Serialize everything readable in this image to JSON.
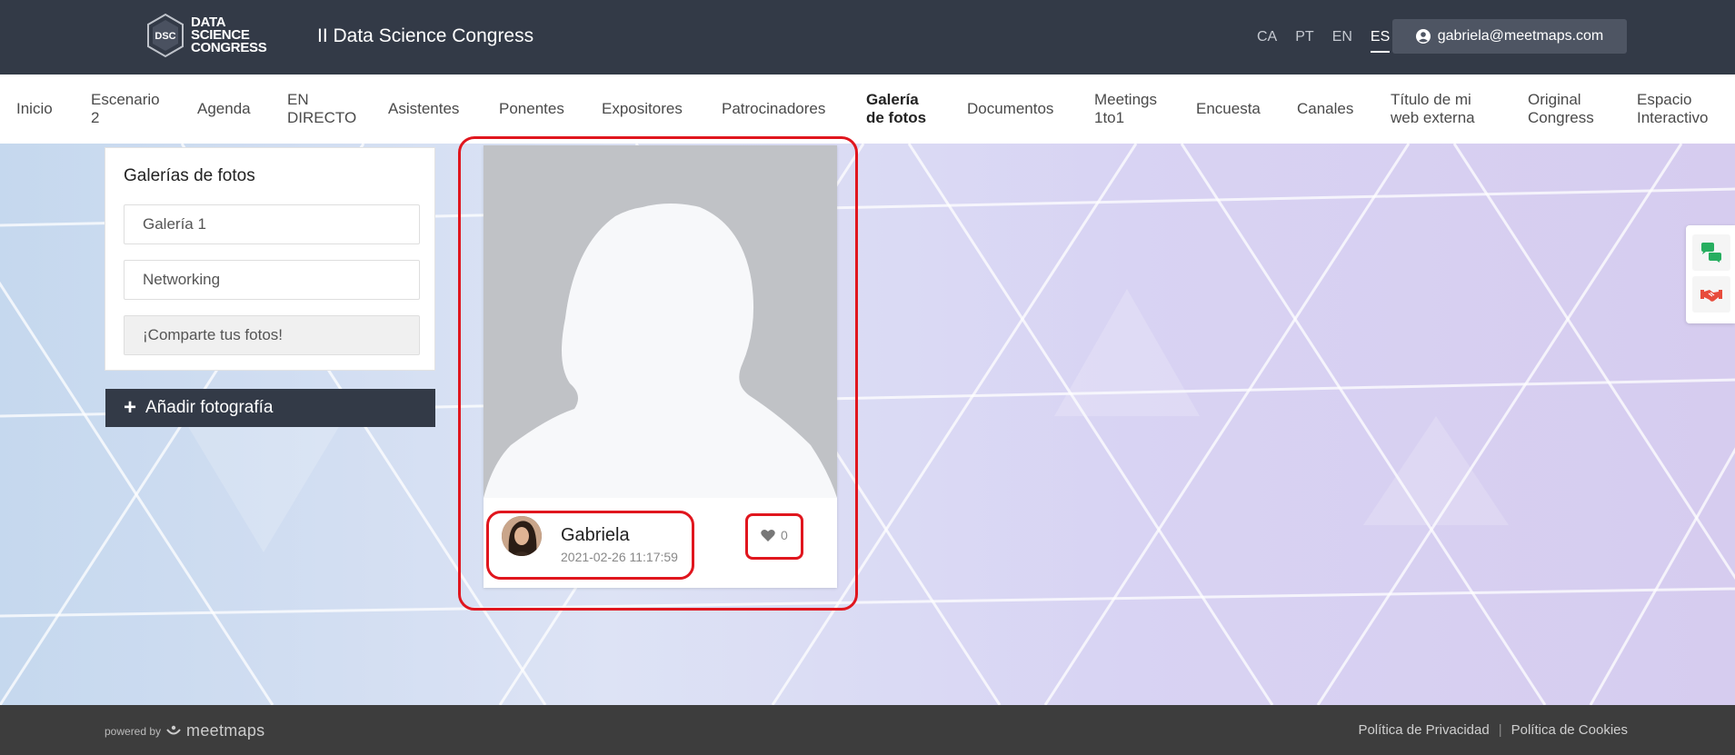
{
  "header": {
    "logo_lines": [
      "DATA",
      "SCIENCE",
      "CONGRESS"
    ],
    "logo_badge": "DSC",
    "title": "II Data Science Congress",
    "languages": [
      "CA",
      "PT",
      "EN",
      "ES"
    ],
    "active_language": "ES",
    "user_email": "gabriela@meetmaps.com"
  },
  "nav": {
    "items": [
      {
        "label": "Inicio"
      },
      {
        "label": "Escenario 2"
      },
      {
        "label": "Agenda"
      },
      {
        "label": "EN DIRECTO"
      },
      {
        "label": "Asistentes"
      },
      {
        "label": "Ponentes"
      },
      {
        "label": "Expositores"
      },
      {
        "label": "Patrocinadores"
      },
      {
        "label": "Galería de fotos"
      },
      {
        "label": "Documentos"
      },
      {
        "label": "Meetings 1to1"
      },
      {
        "label": "Encuesta"
      },
      {
        "label": "Canales"
      },
      {
        "label": "Título de mi web externa"
      },
      {
        "label": "Original Congress"
      },
      {
        "label": "Espacio Interactivo"
      }
    ],
    "active": "Galería de fotos"
  },
  "sidebar": {
    "title": "Galerías de fotos",
    "galleries": [
      "Galería 1",
      "Networking",
      "¡Comparte tus fotos!"
    ],
    "selected": "¡Comparte tus fotos!",
    "add_button": "Añadir fotografía"
  },
  "photo_card": {
    "author": "Gabriela",
    "timestamp": "2021-02-26 11:17:59",
    "likes": "0"
  },
  "footer": {
    "powered_by": "powered by",
    "brand": "meetmaps",
    "links": [
      "Política de Privacidad",
      "Política de Cookies"
    ]
  },
  "colors": {
    "header_bg": "#333a47",
    "footer_bg": "#3d3d3d",
    "highlight": "#e0161e",
    "chat_icon": "#27ae60",
    "meeting_icon": "#e74c3c"
  },
  "icons": {
    "user": "user-circle-icon",
    "plus": "plus-icon",
    "like": "heart-icon",
    "chat": "chat-bubbles-icon",
    "meeting": "handshake-icon"
  }
}
